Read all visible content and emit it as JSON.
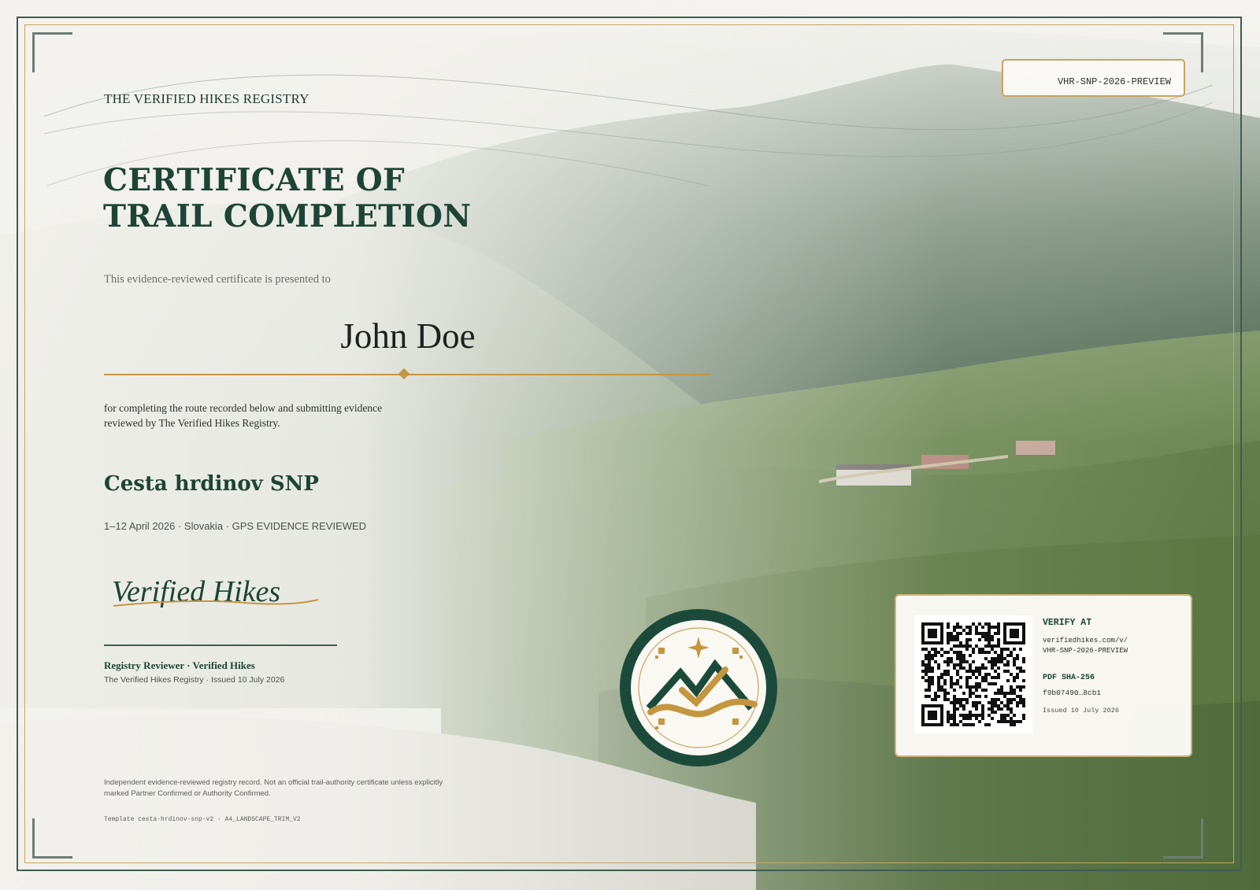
{
  "registry": {
    "name": "THE VERIFIED HIKES REGISTRY"
  },
  "certificate": {
    "id": "VHR-SNP-2026-PREVIEW",
    "title_line1": "CERTIFICATE OF",
    "title_line2": "TRAIL COMPLETION",
    "presented_text": "This evidence-reviewed certificate is presented to",
    "recipient": "John Doe",
    "completion_line1": "for completing the route recorded below and submitting evidence",
    "completion_line2": "reviewed by The Verified Hikes Registry."
  },
  "route": {
    "name": "Cesta hrdinov SNP",
    "meta": "1–12 April 2026 · Slovakia · GPS EVIDENCE REVIEWED"
  },
  "signature": {
    "signature_text": "Verified Hikes",
    "reviewer_title": "Registry Reviewer · Verified Hikes",
    "reviewer_meta": "The Verified Hikes Registry · Issued 10 July 2026"
  },
  "footer": {
    "disclaimer_line1": "Independent evidence-reviewed registry record. Not an official trail-authority certificate unless explicitly",
    "disclaimer_line2": "marked Partner Confirmed or Authority Confirmed.",
    "template_id": "Template cesta-hrdinov-snp-v2 · A4_LANDSCAPE_TRIM_V2"
  },
  "verify": {
    "label": "VERIFY AT",
    "url_line1": "verifiedhikes.com/v/",
    "url_line2": "VHR-SNP-2026-PREVIEW",
    "hash_label": "PDF SHA-256",
    "hash_value": "f9b07490…8cb1",
    "issued": "Issued 10 July 2026"
  },
  "colors": {
    "brand_green": "#1d4436",
    "accent_gold": "#c4963f",
    "frame_gold": "#c9a45e"
  },
  "icons": {
    "seal": "mountain-check-seal-icon",
    "qr": "qr-code-icon"
  }
}
